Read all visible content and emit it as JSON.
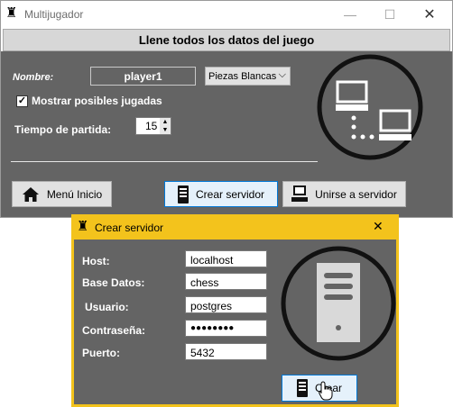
{
  "main_window": {
    "title": "Multijugador",
    "header": "Llene todos los datos del juego",
    "name_label": "Nombre:",
    "name_value": "player1",
    "pieces_select": "Piezas Blancas",
    "show_moves_label": "Mostrar posibles jugadas",
    "show_moves_checked": true,
    "time_label": "Tiempo de partida:",
    "time_value": "15",
    "buttons": {
      "menu": "Menú Inicio",
      "create_server": "Crear servidor",
      "join_server": "Unirse a servidor"
    }
  },
  "dialog": {
    "title": "Crear servidor",
    "fields": {
      "host": {
        "label": "Host:",
        "value": "localhost"
      },
      "database": {
        "label": "Base Datos:",
        "value": "chess"
      },
      "user": {
        "label": "Usuario:",
        "value": "postgres"
      },
      "password": {
        "label": "Contraseña:",
        "value": "●●●●●●●●"
      },
      "port": {
        "label": "Puerto:",
        "value": "5432"
      }
    },
    "create_button": "Crear"
  },
  "colors": {
    "panel": "#646464",
    "dialog_accent": "#f3c31c",
    "active_button_border": "#0078d7"
  }
}
